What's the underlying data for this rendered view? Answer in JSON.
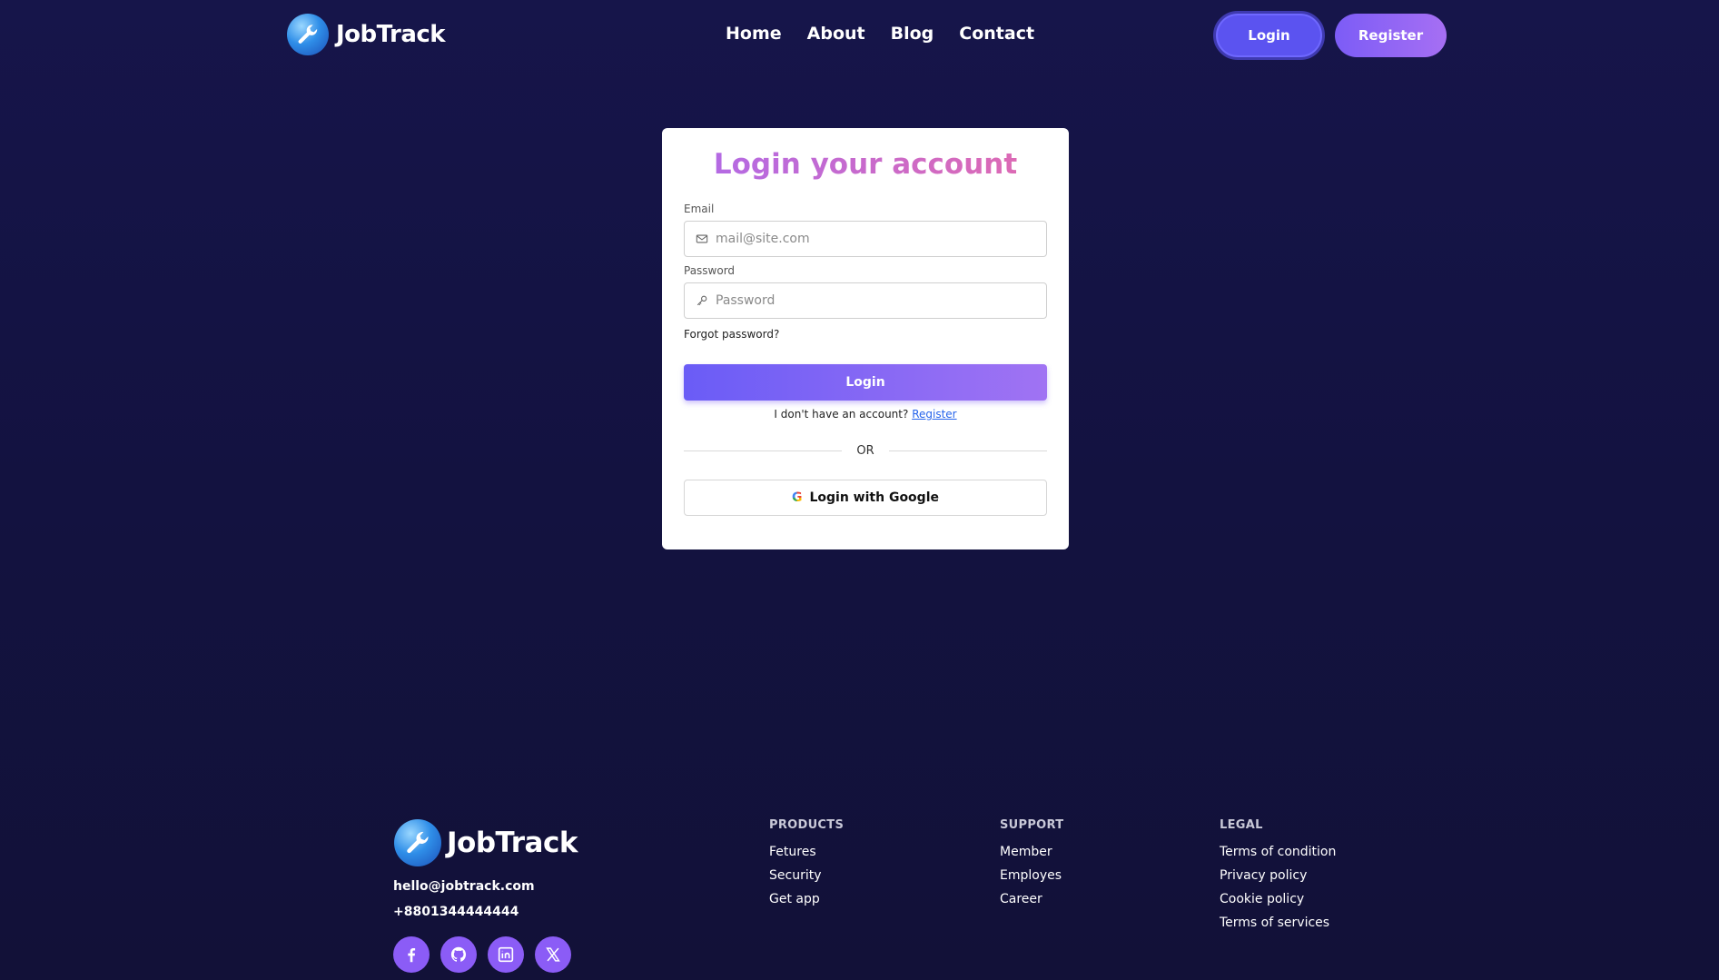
{
  "nav": {
    "brand": "JobTrack",
    "links": [
      "Home",
      "About",
      "Blog",
      "Contact"
    ],
    "login_label": "Login",
    "register_label": "Register"
  },
  "login_card": {
    "title": "Login your account",
    "email_label": "Email",
    "email_placeholder": "mail@site.com",
    "password_label": "Password",
    "password_placeholder": "Password",
    "forgot_label": "Forgot password?",
    "login_button": "Login",
    "no_account_text": "I don't have an account?",
    "register_link": "Register",
    "or_text": "OR",
    "google_button": "Login with Google"
  },
  "footer": {
    "brand": "JobTrack",
    "email": "hello@jobtrack.com",
    "phone": "+8801344444444",
    "socials": [
      "facebook-icon",
      "github-icon",
      "linkedin-icon",
      "x-icon"
    ],
    "columns": [
      {
        "heading": "PRODUCTS",
        "links": [
          "Fetures",
          "Security",
          "Get app"
        ]
      },
      {
        "heading": "SUPPORT",
        "links": [
          "Member",
          "Employes",
          "Career"
        ]
      },
      {
        "heading": "LEGAL",
        "links": [
          "Terms of condition",
          "Privacy policy",
          "Cookie policy",
          "Terms of services"
        ]
      }
    ]
  },
  "colors": {
    "background": "#131240",
    "accent": "#5b53f0",
    "accent_gradient_end": "#a66ff3",
    "title_gradient_start": "#b06ae8",
    "title_gradient_end": "#e06ab0",
    "link": "#2563eb"
  }
}
